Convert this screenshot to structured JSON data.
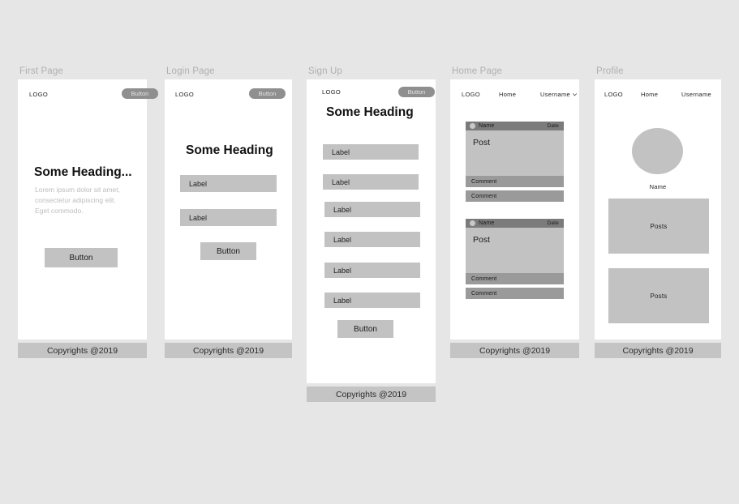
{
  "canvas": {
    "background": "#e6e6e6",
    "card_background": "#ffffff",
    "fill_gray": "#c2c2c2",
    "dark_gray": "#7b7b7b",
    "mid_gray": "#9a9a9a",
    "footer_gray": "#c4c4c4",
    "pill_gray": "#8f8f8f",
    "label_gray": "#b0b0b0"
  },
  "common": {
    "logo": "LOGO",
    "pill_button": "Button",
    "footer": "Copyrights @2019",
    "field_label": "Label",
    "box_button": "Button"
  },
  "screens": [
    {
      "id": "first-page",
      "label": "First Page",
      "header": {
        "logo": "LOGO",
        "button": "Button"
      },
      "heading": "Some Heading...",
      "body_text": "Lorem ipsum dolor sit amet, consectetur adipiscing elit. Eget commodo.",
      "cta": "Button",
      "footer": "Copyrights @2019"
    },
    {
      "id": "login-page",
      "label": "Login Page",
      "header": {
        "logo": "LOGO",
        "button": "Button"
      },
      "heading": "Some Heading",
      "fields": [
        "Label",
        "Label"
      ],
      "cta": "Button",
      "footer": "Copyrights @2019"
    },
    {
      "id": "sign-up",
      "label": "Sign Up",
      "header": {
        "logo": "LOGO",
        "button": "Button"
      },
      "heading": "Some Heading",
      "fields": [
        "Label",
        "Label",
        "Label",
        "Label",
        "Label",
        "Label"
      ],
      "cta": "Button",
      "footer": "Copyrights @2019"
    },
    {
      "id": "home-page",
      "label": "Home Page",
      "nav": {
        "logo": "LOGO",
        "home": "Home",
        "username": "Username",
        "chevron": "chevron-down-icon"
      },
      "posts": [
        {
          "name": "Name",
          "date": "Date",
          "body": "Post",
          "comments": [
            "Comment",
            "Comment"
          ]
        },
        {
          "name": "Name",
          "date": "Date",
          "body": "Post",
          "comments": [
            "Comment",
            "Comment"
          ]
        }
      ],
      "footer": "Copyrights @2019"
    },
    {
      "id": "profile",
      "label": "Profile",
      "nav": {
        "logo": "LOGO",
        "home": "Home",
        "username": "Username"
      },
      "avatar": "avatar",
      "name": "Name",
      "post_blocks": [
        "Posts",
        "Posts"
      ],
      "footer": "Copyrights @2019"
    }
  ]
}
